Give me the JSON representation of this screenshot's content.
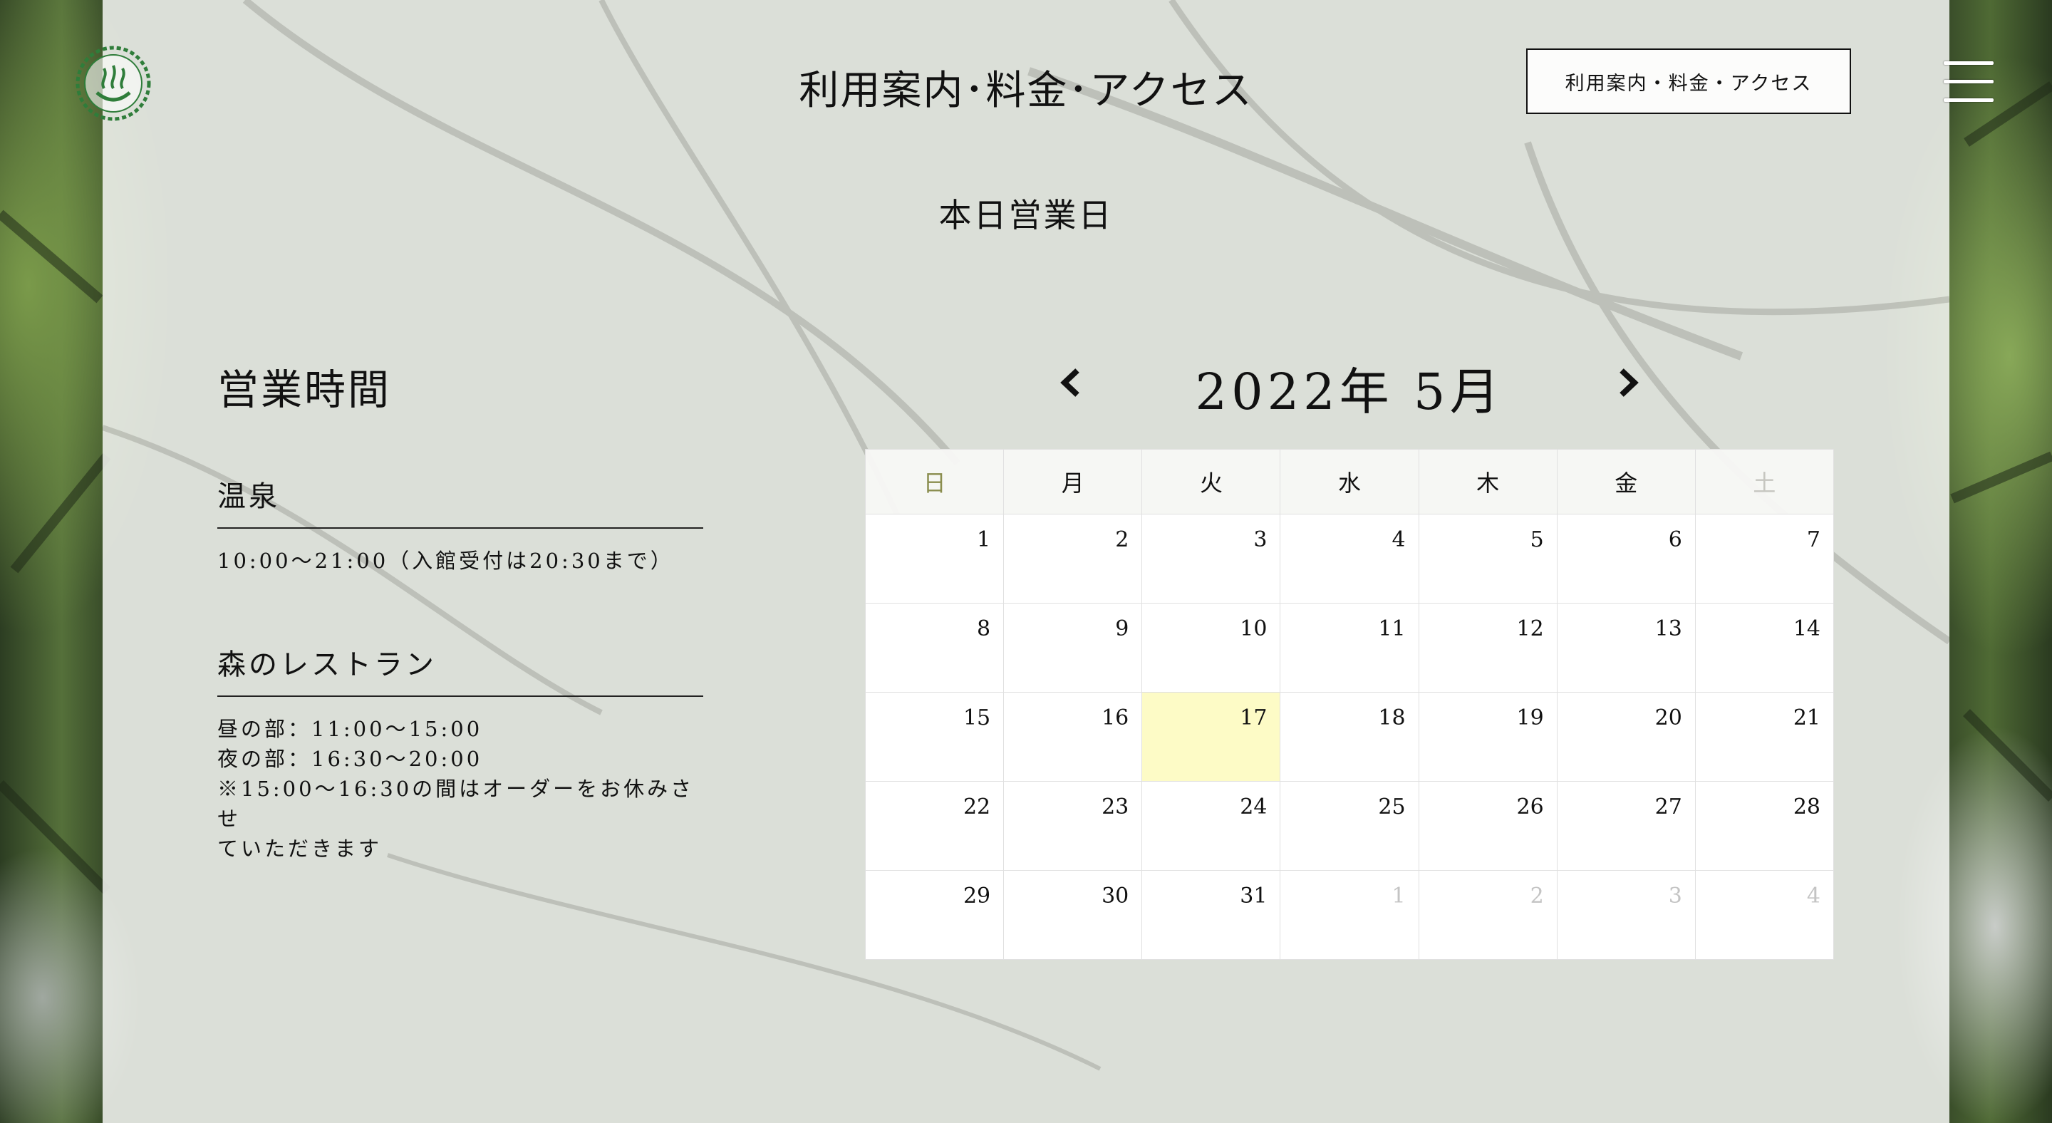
{
  "header": {
    "title": "利用案内･料金･アクセス",
    "nav_button_label": "利用案内・料金・アクセス"
  },
  "icons": {
    "logo": "onsen-symbol-icon",
    "menu": "hamburger-menu-icon",
    "prev": "chevron-left-icon",
    "next": "chevron-right-icon"
  },
  "colors": {
    "today_highlight": "#fdfbc6",
    "sunday": "#8a8d4e",
    "saturday": "#c6c6c0",
    "logo_green": "#2f7d3a"
  },
  "status": "本日営業日",
  "hours": {
    "title": "営業時間",
    "sections": [
      {
        "title": "温泉",
        "lines": [
          "10:00〜21:00（入館受付は20:30まで）"
        ]
      },
      {
        "title": "森のレストラン",
        "lines": [
          "昼の部：11:00〜15:00",
          "夜の部：16:30〜20:00",
          "※15:00〜16:30の間はオーダーをお休みさせ",
          "ていただきます"
        ]
      }
    ]
  },
  "calendar": {
    "title": "2022年 5月",
    "weekdays": [
      "日",
      "月",
      "火",
      "水",
      "木",
      "金",
      "土"
    ],
    "weeks": [
      [
        "1",
        "2",
        "3",
        "4",
        "5",
        "6",
        "7"
      ],
      [
        "8",
        "9",
        "10",
        "11",
        "12",
        "13",
        "14"
      ],
      [
        "15",
        "16",
        "17",
        "18",
        "19",
        "20",
        "21"
      ],
      [
        "22",
        "23",
        "24",
        "25",
        "26",
        "27",
        "28"
      ],
      [
        "29",
        "30",
        "31",
        "1",
        "2",
        "3",
        "4"
      ]
    ],
    "today": "17",
    "trailing_days_next_month": 4
  }
}
